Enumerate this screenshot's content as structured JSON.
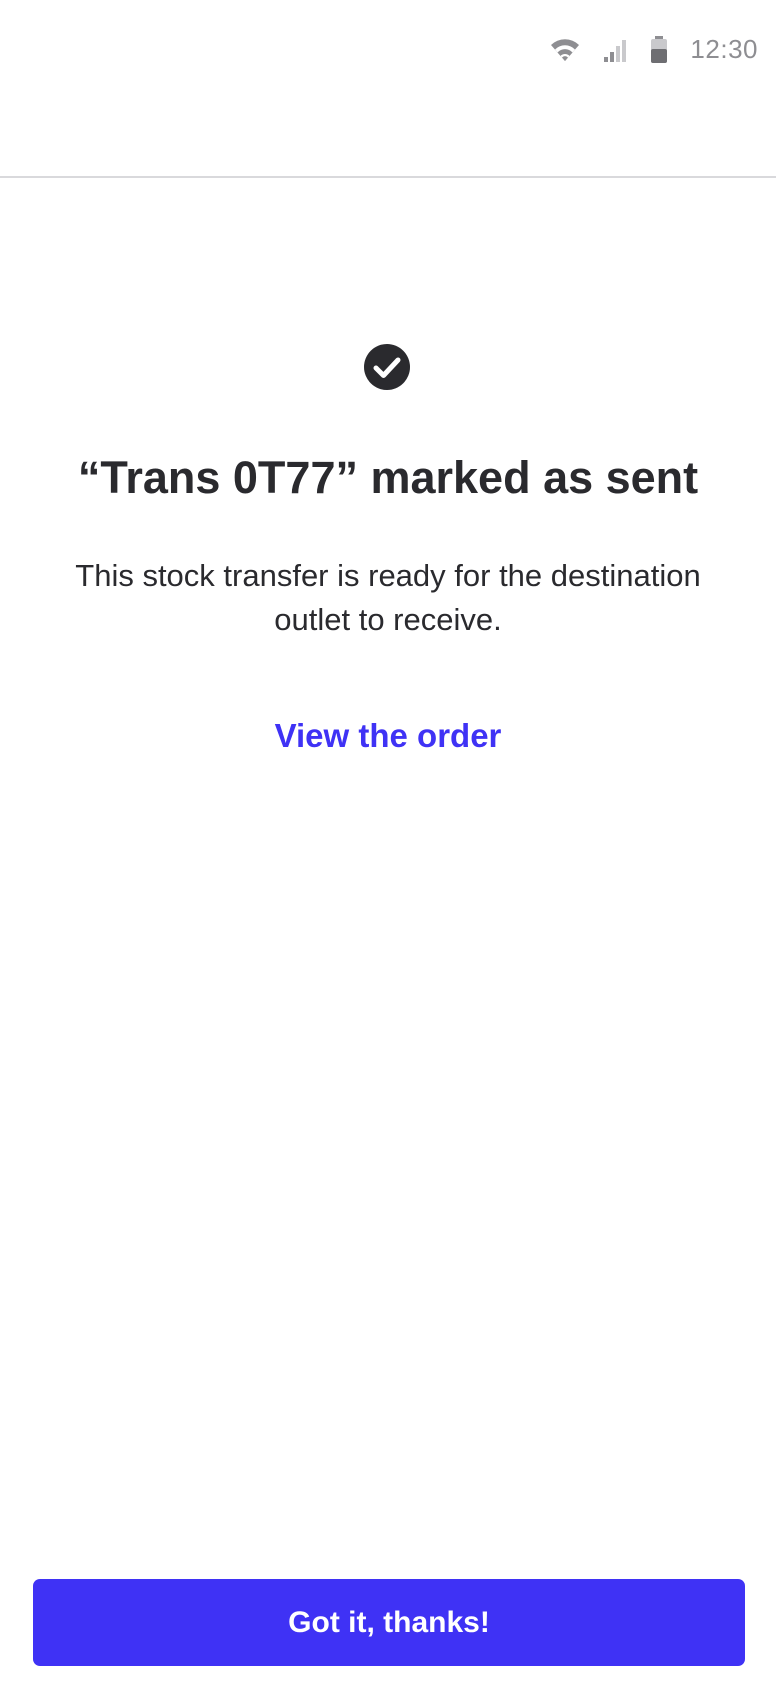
{
  "status_bar": {
    "time": "12:30",
    "icons": [
      "wifi-icon",
      "cell-signal-icon",
      "battery-icon"
    ],
    "icon_color": "#8e8e92"
  },
  "confirmation": {
    "icon": "check-circle-icon",
    "title": "“Trans 0T77” marked as sent",
    "message": "This stock transfer is ready for the destination outlet to receive.",
    "link_label": "View the order"
  },
  "footer": {
    "primary_button_label": "Got it, thanks!"
  },
  "colors": {
    "accent": "#3f32f5",
    "text": "#2a2a2e",
    "divider": "#d9d9dc",
    "background": "#ffffff"
  }
}
